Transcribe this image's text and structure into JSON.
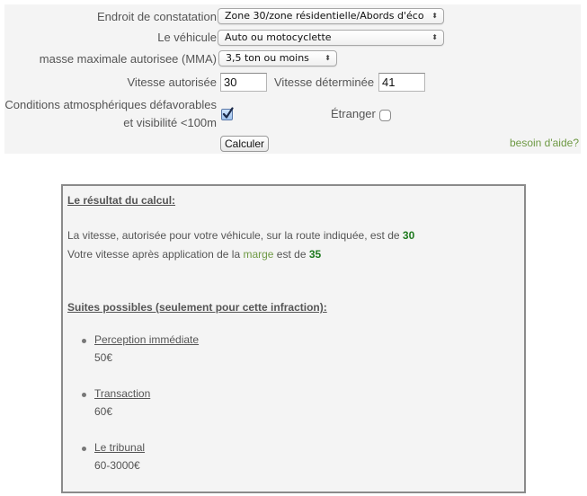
{
  "form": {
    "fields": {
      "location": {
        "label": "Endroit de constatation",
        "value": "Zone 30/zone résidentielle/Abords d'éco"
      },
      "vehicle": {
        "label": "Le véhicule",
        "value": "Auto ou motocyclette"
      },
      "mma": {
        "label": "masse maximale autorisee (MMA)",
        "value": "3,5 ton ou moins"
      },
      "speed_allowed": {
        "label": "Vitesse autorisée",
        "value": "30"
      },
      "speed_measured": {
        "label": "Vitesse déterminée",
        "value": "41"
      },
      "weather": {
        "label_line1": "Conditions atmosphériques défavorables",
        "label_line2": "et visibilité <100m",
        "checked": true
      },
      "foreigner": {
        "label": "Étranger",
        "checked": false
      }
    },
    "select_arrows": "▲▼",
    "calculate_button": "Calculer",
    "help_link": "besoin d'aide?"
  },
  "result": {
    "heading": "Le résultat du calcul:",
    "line1_prefix": "La vitesse, autorisée pour votre véhicule, sur la route indiquée, est de ",
    "line1_value": "30",
    "line2_prefix": "Votre vitesse après application de la ",
    "line2_link": "marge",
    "line2_middle": " est de ",
    "line2_value": "35",
    "options_heading": "Suites possibles (seulement pour cette infraction):",
    "options": [
      {
        "label": "Perception immédiate",
        "amount": "50€"
      },
      {
        "label": "Transaction",
        "amount": "60€"
      },
      {
        "label": "Le tribunal",
        "amount": "60-3000€"
      }
    ]
  },
  "colors": {
    "panel_bg": "#f4f4f4",
    "text": "#555555",
    "accent_green": "#1f7a1f",
    "link_green": "#6f9a45"
  }
}
